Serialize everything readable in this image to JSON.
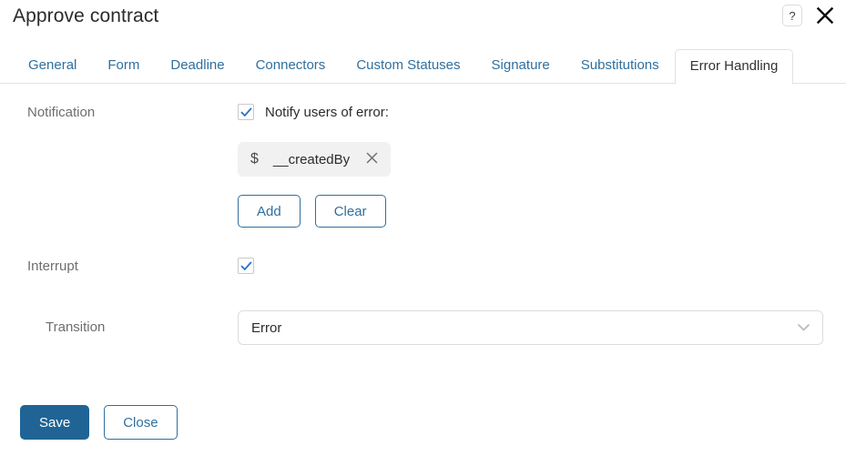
{
  "header": {
    "title": "Approve contract",
    "help_icon": "question-mark-icon",
    "help_glyph": "?",
    "close_icon": "close-icon"
  },
  "tabs": [
    {
      "label": "General",
      "active": false
    },
    {
      "label": "Form",
      "active": false
    },
    {
      "label": "Deadline",
      "active": false
    },
    {
      "label": "Connectors",
      "active": false
    },
    {
      "label": "Custom Statuses",
      "active": false
    },
    {
      "label": "Signature",
      "active": false
    },
    {
      "label": "Substitutions",
      "active": false
    },
    {
      "label": "Error Handling",
      "active": true
    }
  ],
  "form": {
    "notification": {
      "label": "Notification",
      "checkbox_label": "Notify users of error:",
      "checkbox_checked": true,
      "chip": {
        "sigil": "$",
        "text": "__createdBy",
        "remove_icon": "close-icon"
      },
      "add_label": "Add",
      "clear_label": "Clear"
    },
    "interrupt": {
      "label": "Interrupt",
      "checkbox_checked": true
    },
    "transition": {
      "label": "Transition",
      "value": "Error",
      "arrow_icon": "chevron-down-icon"
    }
  },
  "footer": {
    "save_label": "Save",
    "close_label": "Close"
  },
  "colors": {
    "accent_blue": "#2f6f9f",
    "primary_button": "#1f6494",
    "label_gray": "#6e6e6e",
    "border_gray": "#dcdcdc",
    "chip_bg": "#f1f1f1"
  }
}
